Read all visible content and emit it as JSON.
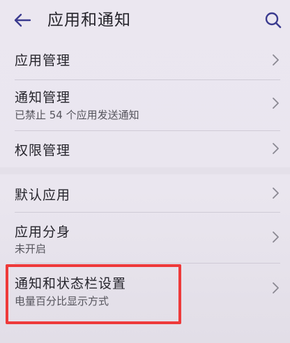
{
  "header": {
    "title": "应用和通知"
  },
  "items": [
    {
      "title": "应用管理",
      "subtitle": ""
    },
    {
      "title": "通知管理",
      "subtitle": "已禁止 54 个应用发送通知"
    },
    {
      "title": "权限管理",
      "subtitle": ""
    },
    {
      "title": "默认应用",
      "subtitle": ""
    },
    {
      "title": "应用分身",
      "subtitle": "未开启"
    },
    {
      "title": "通知和状态栏设置",
      "subtitle": "电量百分比显示方式"
    }
  ],
  "colors": {
    "background": "#ebe7f0",
    "accent": "#3b3b8f",
    "highlight_border": "#ee3a3a"
  }
}
